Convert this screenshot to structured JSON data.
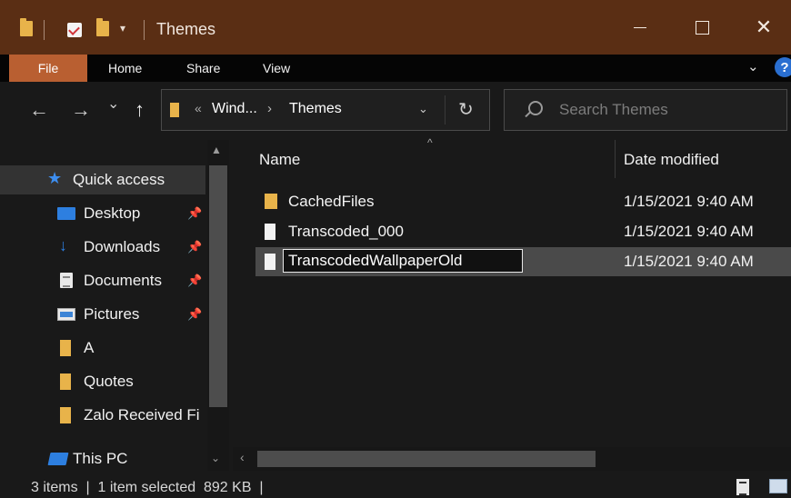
{
  "window": {
    "title": "Themes",
    "quick_access_dropdown": "▾"
  },
  "ribbon": {
    "tabs": [
      "File",
      "Home",
      "Share",
      "View"
    ]
  },
  "nav": {
    "back": "←",
    "forward": "→",
    "recent": "⌄",
    "up": "↑",
    "address_overflow": "«",
    "breadcrumbs": [
      "Wind...",
      "Themes"
    ],
    "breadcrumb_separator": "›",
    "search_placeholder": "Search Themes"
  },
  "sidebar": {
    "items": [
      {
        "label": "Quick access",
        "icon": "star-icon"
      },
      {
        "label": "Desktop",
        "icon": "desktop-icon",
        "pinned": true
      },
      {
        "label": "Downloads",
        "icon": "downloads-icon",
        "pinned": true
      },
      {
        "label": "Documents",
        "icon": "documents-icon",
        "pinned": true
      },
      {
        "label": "Pictures",
        "icon": "pictures-icon",
        "pinned": true
      },
      {
        "label": "A",
        "icon": "folder-icon"
      },
      {
        "label": "Quotes",
        "icon": "folder-icon"
      },
      {
        "label": "Zalo Received Fi",
        "icon": "folder-icon"
      },
      {
        "label": "This PC",
        "icon": "pc-icon"
      }
    ]
  },
  "columns": {
    "name": "Name",
    "date_modified": "Date modified"
  },
  "files": [
    {
      "name": "CachedFiles",
      "type": "folder",
      "date": "1/15/2021 9:40 AM"
    },
    {
      "name": "Transcoded_000",
      "type": "file",
      "date": "1/15/2021 9:40 AM"
    },
    {
      "name": "TranscodedWallpaperOld",
      "type": "file",
      "date": "1/15/2021 9:40 AM",
      "selected": true,
      "renaming": true
    }
  ],
  "status": {
    "text": "3 items  |  1 item selected  892 KB  |"
  },
  "colors": {
    "title_bar": "#5a2e14",
    "file_tab": "#b95f31",
    "accent_blue": "#2d7fe0",
    "folder": "#e8b34a"
  }
}
